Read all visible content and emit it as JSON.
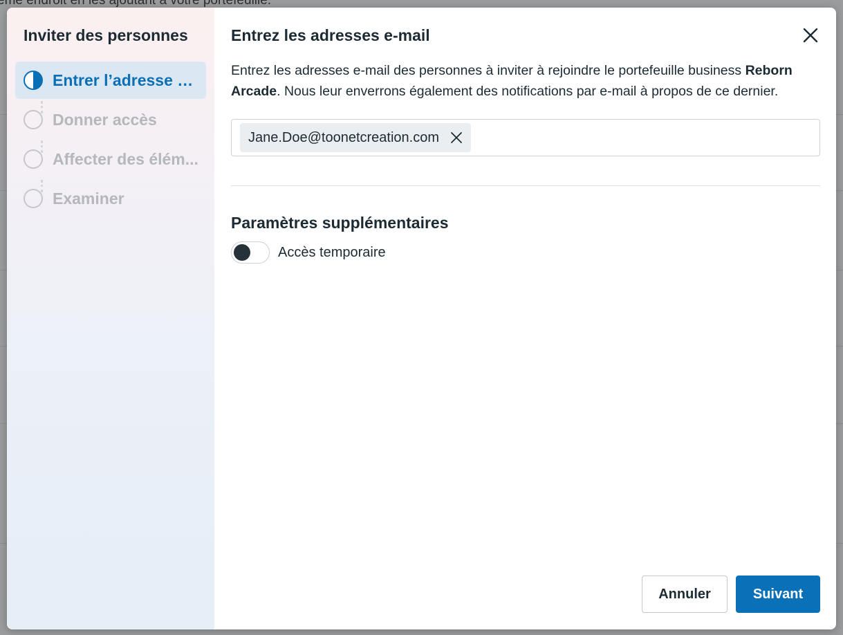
{
  "background": {
    "partial_text": "ème endroit en les ajoutant à votre portefeuille."
  },
  "sidebar": {
    "title": "Inviter des personnes",
    "steps": [
      {
        "label": "Entrer l’adresse e...",
        "state": "active"
      },
      {
        "label": "Donner accès",
        "state": "pending"
      },
      {
        "label": "Affecter des élém...",
        "state": "pending"
      },
      {
        "label": "Examiner",
        "state": "pending"
      }
    ]
  },
  "main": {
    "title": "Entrez les adresses e-mail",
    "close_icon": "close-icon",
    "description": {
      "before": "Entrez les adresses e-mail des personnes à inviter à rejoindre le portefeuille business ",
      "business_name": "Reborn Arcade",
      "after": ". Nous leur enverrons également des notifications par e-mail à propos de ce dernier."
    },
    "emails": [
      {
        "address": "Jane.Doe@toonetcreation.com"
      }
    ],
    "additional_settings": {
      "title": "Paramètres supplémentaires",
      "temporary_access": {
        "label": "Accès temporaire",
        "enabled": false
      }
    }
  },
  "footer": {
    "cancel_label": "Annuler",
    "next_label": "Suivant"
  },
  "colors": {
    "accent": "#0a70b8",
    "text": "#1c2b33",
    "muted_step": "#b4b8bc",
    "active_step_bg": "#dbe8f3"
  }
}
